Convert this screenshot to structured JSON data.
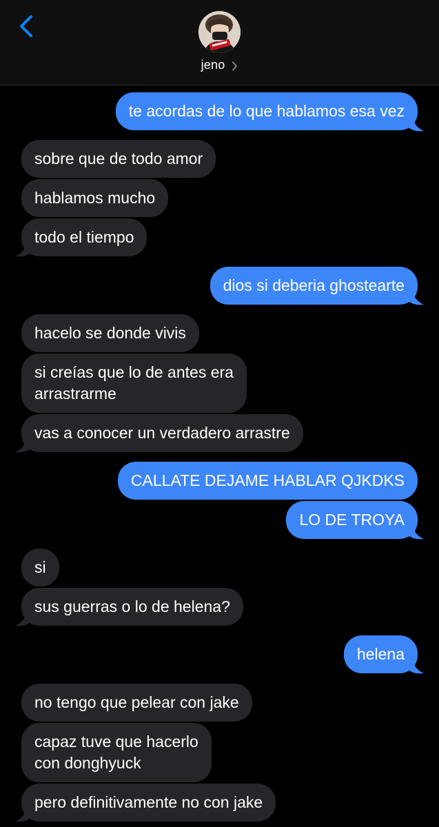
{
  "header": {
    "contact_name": "jeno",
    "back_icon": "chevron-left-icon",
    "chevron_icon": "chevron-right-icon",
    "accent_color": "#0a84ff"
  },
  "colors": {
    "incoming_bubble": "#26252a",
    "outgoing_bubble": "#3d86f7",
    "background": "#000000"
  },
  "messages": [
    {
      "direction": "out",
      "text": "te acordas de lo que hablamos esa vez"
    },
    {
      "direction": "in",
      "text": "sobre que de todo amor"
    },
    {
      "direction": "in",
      "text": "hablamos mucho"
    },
    {
      "direction": "in",
      "text": "todo el tiempo"
    },
    {
      "direction": "out",
      "text": "dios si deberia ghostearte"
    },
    {
      "direction": "in",
      "text": "hacelo se donde vivis"
    },
    {
      "direction": "in",
      "text": "si creías que lo de antes era",
      "text2": "arrastrarme"
    },
    {
      "direction": "in",
      "text": "vas a conocer un verdadero arrastre"
    },
    {
      "direction": "out",
      "text": "CALLATE DEJAME HABLAR QJKDKS"
    },
    {
      "direction": "out",
      "text": "LO DE TROYA"
    },
    {
      "direction": "in",
      "text": "si"
    },
    {
      "direction": "in",
      "text": "sus guerras o lo de helena?"
    },
    {
      "direction": "out",
      "text": "helena"
    },
    {
      "direction": "in",
      "text": "no tengo que pelear con jake"
    },
    {
      "direction": "in",
      "text": "capaz tuve que hacerlo",
      "text2": "con donghyuck"
    },
    {
      "direction": "in",
      "text": "pero definitivamente no con jake"
    }
  ]
}
